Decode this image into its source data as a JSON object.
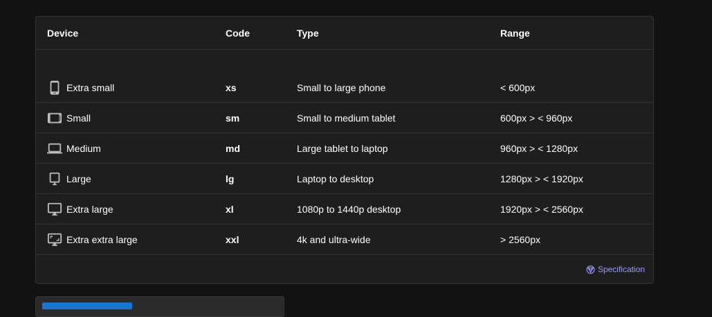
{
  "table": {
    "headers": {
      "device": "Device",
      "code": "Code",
      "type": "Type",
      "range": "Range"
    },
    "rows": [
      {
        "icon": "phone-icon",
        "device": "Extra small",
        "code": "xs",
        "type": "Small to large phone",
        "range": "< 600px"
      },
      {
        "icon": "tablet-icon",
        "device": "Small",
        "code": "sm",
        "type": "Small to medium tablet",
        "range": "600px > < 960px"
      },
      {
        "icon": "laptop-icon",
        "device": "Medium",
        "code": "md",
        "type": "Large tablet to laptop",
        "range": "960px > < 1280px"
      },
      {
        "icon": "desktop-small-icon",
        "device": "Large",
        "code": "lg",
        "type": "Laptop to desktop",
        "range": "1280px > < 1920px"
      },
      {
        "icon": "monitor-icon",
        "device": "Extra large",
        "code": "xl",
        "type": "1080p to 1440p desktop",
        "range": "1920px > < 2560px"
      },
      {
        "icon": "widescreen-icon",
        "device": "Extra extra large",
        "code": "xxl",
        "type": "4k and ultra-wide",
        "range": "> 2560px"
      }
    ]
  },
  "footer": {
    "spec_link_label": "Specification",
    "spec_icon": "material-design-icon"
  },
  "colors": {
    "background": "#121212",
    "card": "#1e1e1e",
    "divider": "#333333",
    "link": "#9b9bff",
    "accent": "#1976d2"
  }
}
